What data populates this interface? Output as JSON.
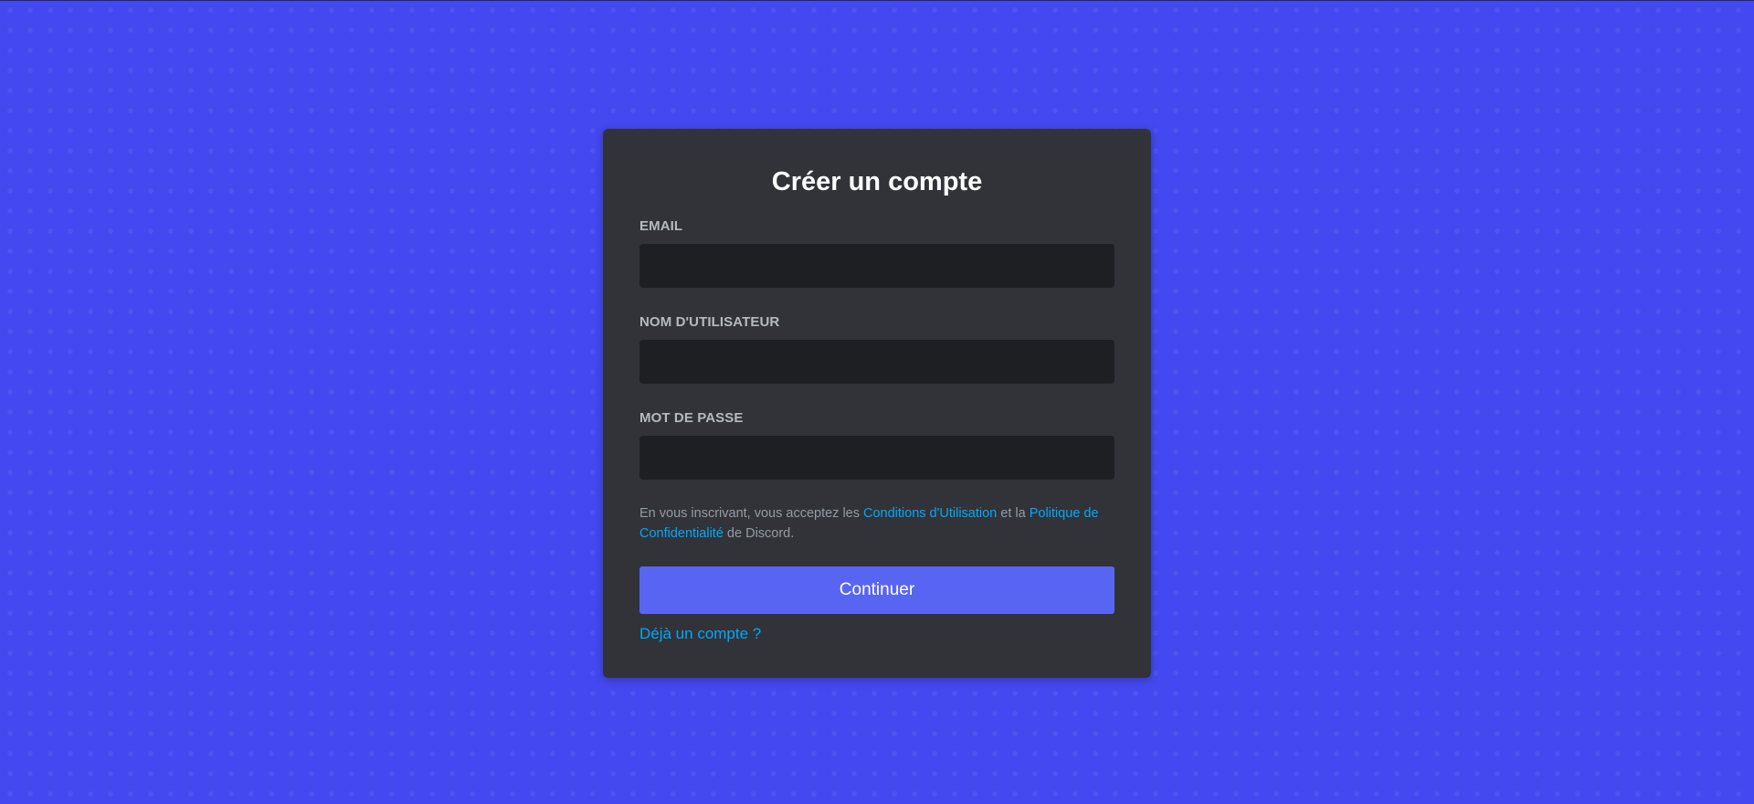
{
  "register": {
    "title": "Créer un compte",
    "email_label": "EMAIL",
    "email_value": "",
    "username_label": "NOM D'UTILISATEUR",
    "username_value": "",
    "password_label": "MOT DE PASSE",
    "password_value": "",
    "terms_prefix": "En vous inscrivant, vous acceptez les ",
    "terms_link": "Conditions d'Utilisation",
    "terms_middle": " et la ",
    "privacy_link": "Politique de Confidentialité",
    "terms_suffix": " de Discord.",
    "continue_label": "Continuer",
    "login_link": "Déjà un compte ?"
  },
  "colors": {
    "background": "#4448f0",
    "card": "#313338",
    "input": "#1e1f22",
    "button": "#5865f2",
    "link": "#00a8fc",
    "label": "#b5bac1"
  }
}
